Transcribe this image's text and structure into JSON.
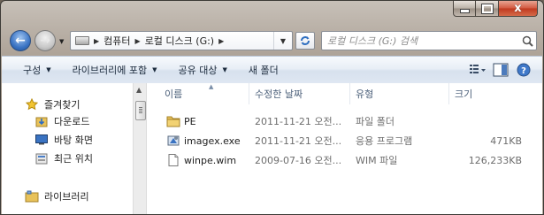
{
  "window": {
    "caption": {
      "minimize": "",
      "maximize": "",
      "close": "x"
    }
  },
  "address": {
    "segments": [
      "컴퓨터",
      "로컬 디스크 (G:)"
    ],
    "search_placeholder": "로컬 디스크 (G:) 검색"
  },
  "toolbar": {
    "organize": "구성",
    "include_in_library": "라이브러리에 포함",
    "share_with": "공유 대상",
    "new_folder": "새 폴더"
  },
  "nav_pane": {
    "favorites": "즐겨찾기",
    "items": [
      "다운로드",
      "바탕 화면",
      "최근 위치"
    ],
    "libraries": "라이브러리"
  },
  "columns": {
    "name": "이름",
    "date_modified": "수정한 날짜",
    "type": "유형",
    "size": "크기"
  },
  "files": [
    {
      "name": "PE",
      "date": "2011-11-21 오전...",
      "type": "파일 폴더",
      "size": "",
      "icon": "folder-icon"
    },
    {
      "name": "imagex.exe",
      "date": "2011-11-21 오전...",
      "type": "응용 프로그램",
      "size": "471KB",
      "icon": "exe-icon"
    },
    {
      "name": "winpe.wim",
      "date": "2009-07-16 오전...",
      "type": "WIM 파일",
      "size": "126,233KB",
      "icon": "file-icon"
    }
  ],
  "colors": {
    "accent": "#3b74c4",
    "command_bar": "#dfe7f2",
    "header_text": "#4c607a",
    "folder": "#e8c25a"
  }
}
